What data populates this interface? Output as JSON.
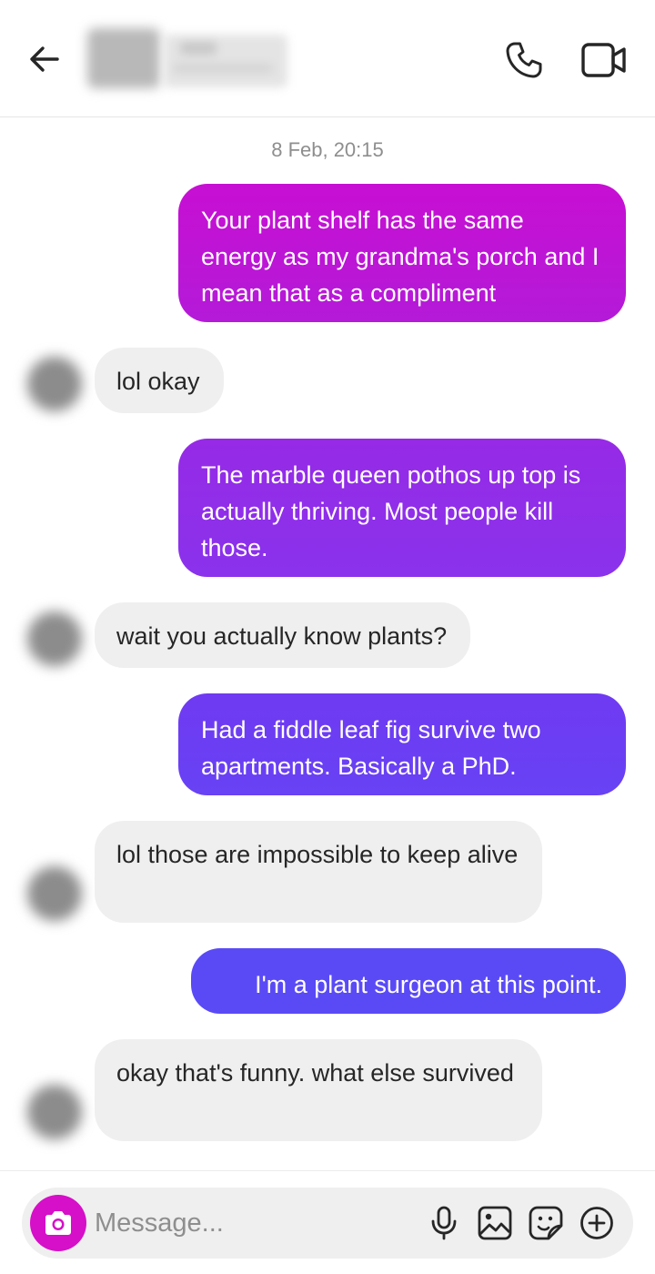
{
  "conversation": {
    "timestamp": "8 Feb, 20:15",
    "messages": [
      {
        "from": "me",
        "text": "Your plant shelf has the same energy as my grandma's porch and I mean that as a compliment",
        "color": "#c40fd3"
      },
      {
        "from": "them",
        "text": "lol okay"
      },
      {
        "from": "me",
        "text": "The marble queen pothos up top is actually thriving. Most people kill those.",
        "color": "#8a2be9"
      },
      {
        "from": "them",
        "text": "wait you actually know plants?"
      },
      {
        "from": "me",
        "text": "Had a fiddle leaf fig survive two apartments. Basically a PhD.",
        "color": "#6a3cf3"
      },
      {
        "from": "them",
        "text": "lol those are impossible to keep alive"
      },
      {
        "from": "me",
        "text": "I'm a plant surgeon at this point.",
        "color": "#5a48f5"
      },
      {
        "from": "them",
        "text": "okay that's funny. what else survived"
      }
    ]
  },
  "composer": {
    "placeholder": "Message...",
    "camera_color": "#d60fc8"
  },
  "icons": {
    "back": "arrow-left-icon",
    "call": "phone-icon",
    "video": "video-camera-icon",
    "camera": "camera-icon",
    "mic": "microphone-icon",
    "gallery": "image-icon",
    "sticker": "sticker-icon",
    "more": "plus-circle-icon"
  }
}
